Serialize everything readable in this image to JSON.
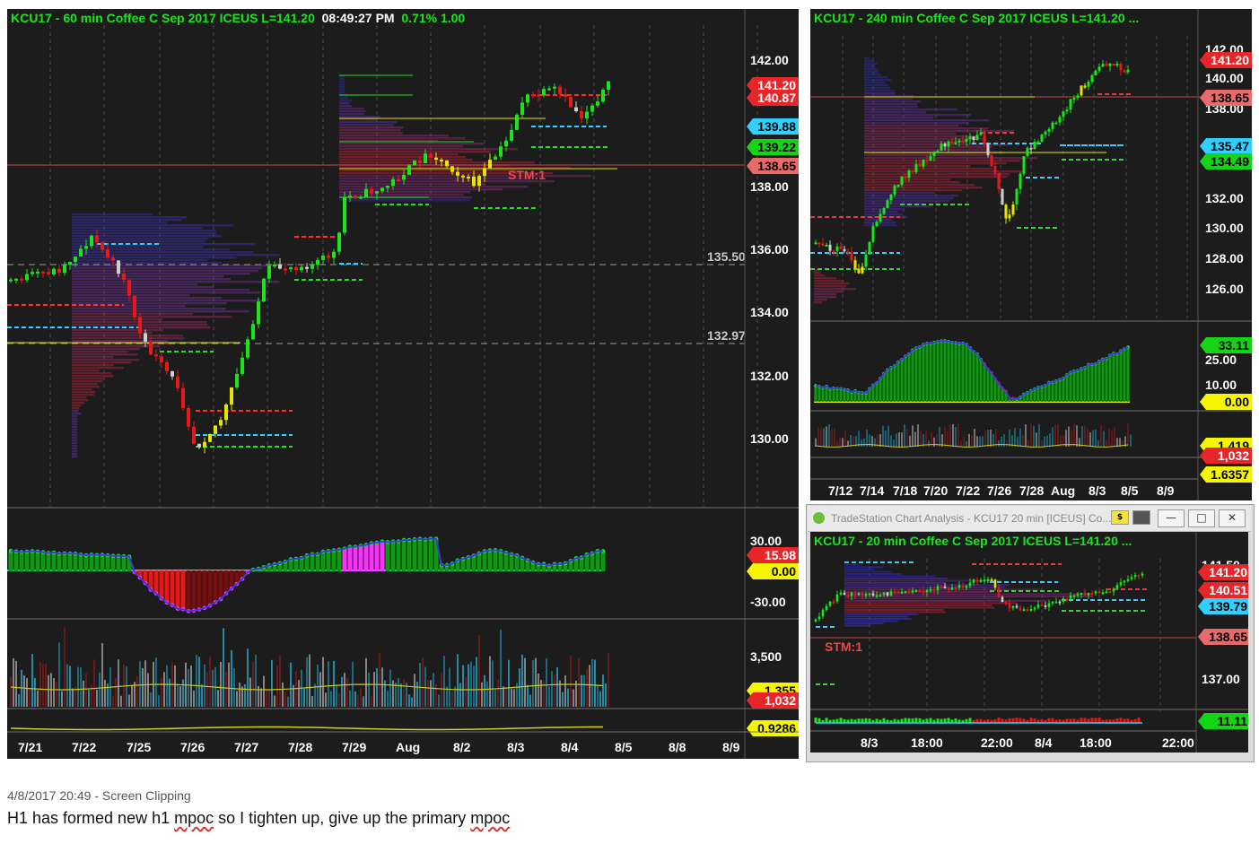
{
  "chart60": {
    "title_left": "KCU17 - 60 min  Coffee C Sep 2017  ICEUS  L=141.20",
    "title_time": "08:49:27 PM",
    "title_right": "0.71%  1.00",
    "price_ticks": [
      "142.00",
      "136.00",
      "134.00",
      "132.00",
      "130.00",
      "138.00"
    ],
    "badges": [
      {
        "text": "141.20",
        "bg": "#e8262a",
        "fg": "#ffffff"
      },
      {
        "text": "140.87",
        "bg": "#e8262a",
        "fg": "#ffffff"
      },
      {
        "text": "139.88",
        "bg": "#2fd0ff",
        "fg": "#000000"
      },
      {
        "text": "139.22",
        "bg": "#15d415",
        "fg": "#000000"
      },
      {
        "text": "138.65",
        "bg": "#e86a6a",
        "fg": "#000000"
      }
    ],
    "level_labels": [
      "135.50",
      "132.97"
    ],
    "stm_label": "STM:1",
    "osc_ticks": [
      "30.00",
      "-30.00"
    ],
    "osc_badges": [
      {
        "text": "15.98",
        "bg": "#e8262a",
        "fg": "#ffffff"
      },
      {
        "text": "0.00",
        "bg": "#f5f500",
        "fg": "#000000"
      }
    ],
    "vol_tick": "3,500",
    "vol_badges": [
      {
        "text": "1,355",
        "bg": "#f5f500",
        "fg": "#000000"
      },
      {
        "text": "1,032",
        "bg": "#e8262a",
        "fg": "#ffffff"
      }
    ],
    "bottom_badge": {
      "text": "0.9286",
      "bg": "#f5f500",
      "fg": "#000000"
    },
    "dates": [
      "7/21",
      "7/22",
      "7/25",
      "7/26",
      "7/27",
      "7/28",
      "7/29",
      "Aug",
      "8/2",
      "8/3",
      "8/4",
      "8/5",
      "8/8",
      "8/9"
    ]
  },
  "chart240": {
    "title": "KCU17 - 240 min  Coffee C Sep 2017  ICEUS  L=141.20  ...",
    "price_ticks": [
      "142.00",
      "140.00",
      "138.00",
      "132.00",
      "130.00",
      "128.00",
      "126.00"
    ],
    "badges": [
      {
        "text": "141.20",
        "bg": "#e8262a",
        "fg": "#ffffff"
      },
      {
        "text": "138.65",
        "bg": "#e86a6a",
        "fg": "#000000"
      },
      {
        "text": "135.47",
        "bg": "#2fd0ff",
        "fg": "#000000"
      },
      {
        "text": "134.49",
        "bg": "#15d415",
        "fg": "#000000"
      }
    ],
    "osc_ticks": [
      "25.00",
      "10.00"
    ],
    "osc_badges": [
      {
        "text": "33.11",
        "bg": "#15d415",
        "fg": "#000000"
      },
      {
        "text": "0.00",
        "bg": "#f5f500",
        "fg": "#000000"
      }
    ],
    "vol_badges": [
      {
        "text": "1,419",
        "bg": "#f5f500",
        "fg": "#000000"
      },
      {
        "text": "1,032",
        "bg": "#e8262a",
        "fg": "#ffffff"
      }
    ],
    "bottom_badge": {
      "text": "1.6357",
      "bg": "#f5f500",
      "fg": "#000000"
    },
    "dates": [
      "7/12",
      "7/14",
      "7/18",
      "7/20",
      "7/22",
      "7/26",
      "7/28",
      "Aug",
      "8/3",
      "8/5",
      "8/9"
    ]
  },
  "chart20": {
    "window_title": "TradeStation Chart Analysis - KCU17 20 min [ICEUS] Co...",
    "title": "KCU17 - 20 min  Coffee C Sep 2017  ICEUS  L=141.20  ...",
    "price_ticks": [
      "141.50",
      "137.00"
    ],
    "badges": [
      {
        "text": "141.20",
        "bg": "#e8262a",
        "fg": "#ffffff"
      },
      {
        "text": "140.51",
        "bg": "#e8262a",
        "fg": "#ffffff"
      },
      {
        "text": "139.79",
        "bg": "#2fd0ff",
        "fg": "#000000"
      },
      {
        "text": "138.65",
        "bg": "#e86a6a",
        "fg": "#000000"
      }
    ],
    "stm_label": "STM:1",
    "osc_badge": {
      "text": "11.11",
      "bg": "#15d415",
      "fg": "#000000"
    },
    "time_labels": [
      "8/3",
      "18:00",
      "22:00",
      "8/4",
      "18:00",
      "22:00"
    ]
  },
  "footer": {
    "timestamp": "4/8/2017 20:49 - Screen Clipping",
    "note_a": "H1 has formed new h1 ",
    "note_b": "mpoc",
    "note_c": " so I tighten up, give up the primary ",
    "note_d": "mpoc"
  }
}
